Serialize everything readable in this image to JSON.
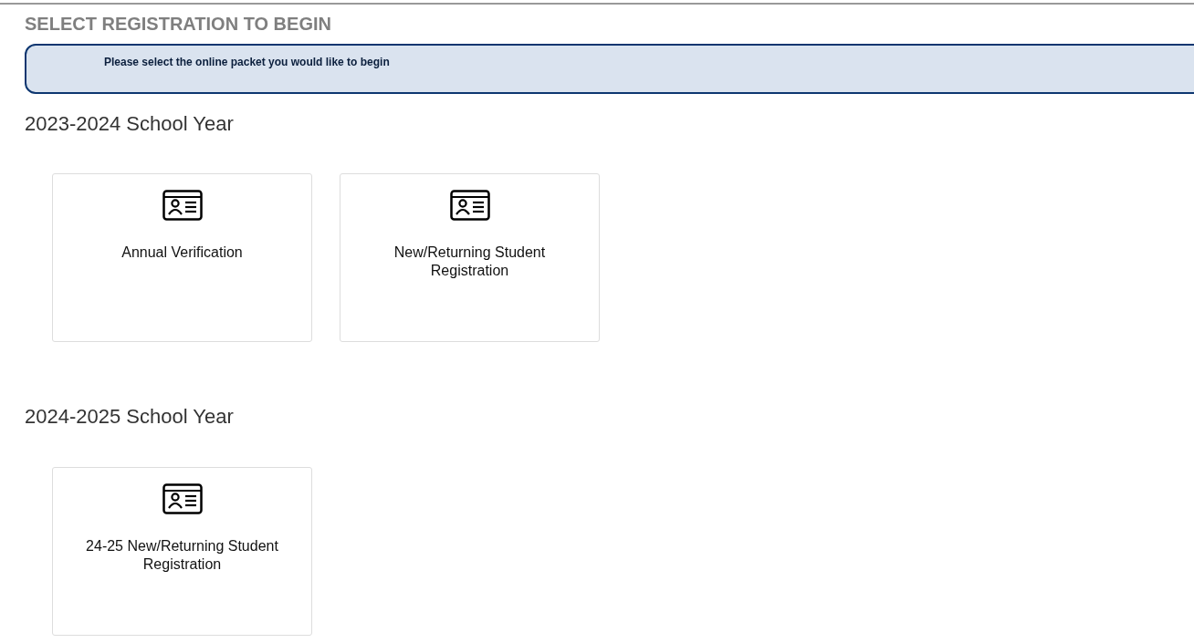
{
  "page_title": "SELECT REGISTRATION TO BEGIN",
  "notice": "Please select the online packet you would like to begin",
  "sections": [
    {
      "title": "2023-2024 School Year",
      "packets": [
        {
          "label": "Annual Verification"
        },
        {
          "label": "New/Returning Student Registration"
        }
      ]
    },
    {
      "title": "2024-2025 School Year",
      "packets": [
        {
          "label": "24-25 New/Returning Student Registration"
        }
      ]
    }
  ]
}
